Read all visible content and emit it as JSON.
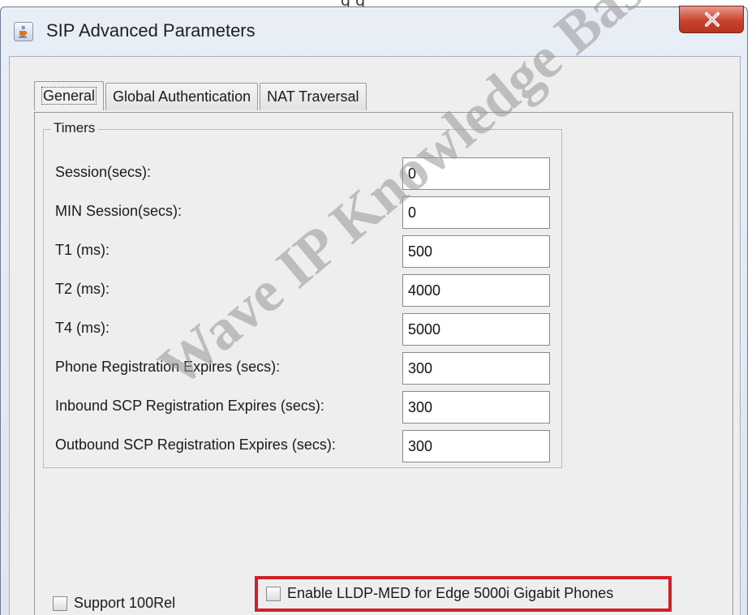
{
  "window": {
    "title": "SIP Advanced Parameters",
    "app_icon": "java-cup-icon",
    "close_icon": "close-icon"
  },
  "background": {
    "partial_text": "g    g"
  },
  "tabs": [
    {
      "label": "General",
      "active": true
    },
    {
      "label": "Global Authentication",
      "active": false
    },
    {
      "label": "NAT Traversal",
      "active": false
    }
  ],
  "timers": {
    "group_title": "Timers",
    "fields": [
      {
        "label": "Session(secs):",
        "value": "0"
      },
      {
        "label": "MIN Session(secs):",
        "value": "0"
      },
      {
        "label": "T1 (ms):",
        "value": "500"
      },
      {
        "label": "T2 (ms):",
        "value": "4000"
      },
      {
        "label": "T4 (ms):",
        "value": "5000"
      },
      {
        "label": "Phone Registration Expires (secs):",
        "value": "300"
      },
      {
        "label": "Inbound SCP Registration Expires (secs):",
        "value": "300"
      },
      {
        "label": "Outbound SCP Registration Expires (secs):",
        "value": "300"
      }
    ]
  },
  "options": {
    "support_100rel": {
      "label": "Support 100Rel",
      "checked": false
    },
    "enable_lldp_med": {
      "label": "Enable LLDP-MED for Edge 5000i Gigabit Phones",
      "checked": false
    }
  },
  "watermark": "Wave IP Knowledge Base",
  "colors": {
    "highlight": "#d21f26",
    "close_button": "#c9432e",
    "watermark": "#969696"
  }
}
